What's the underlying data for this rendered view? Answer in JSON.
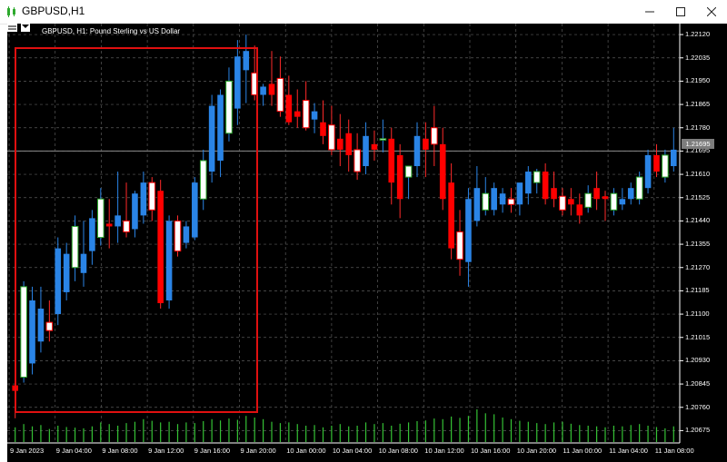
{
  "window": {
    "title": "GBPUSD,H1",
    "buttons": [
      "minimize",
      "maximize",
      "close"
    ]
  },
  "chart": {
    "title": "GBPUSD, H1:  Pound Sterling vs US Dollar",
    "current_price": "1.21695",
    "price_axis": [
      "1.22120",
      "1.22035",
      "1.21950",
      "1.21865",
      "1.21780",
      "1.21695",
      "1.21610",
      "1.21525",
      "1.21440",
      "1.21355",
      "1.21270",
      "1.21185",
      "1.21100",
      "1.21015",
      "1.20930",
      "1.20845",
      "1.20760",
      "1.20675"
    ],
    "time_axis": [
      "9 Jan 2023",
      "9 Jan 04:00",
      "9 Jan 08:00",
      "9 Jan 12:00",
      "9 Jan 16:00",
      "9 Jan 20:00",
      "10 Jan 00:00",
      "10 Jan 04:00",
      "10 Jan 08:00",
      "10 Jan 12:00",
      "10 Jan 16:00",
      "10 Jan 20:00",
      "11 Jan 00:00",
      "11 Jan 04:00",
      "11 Jan 08:00"
    ],
    "colors": {
      "background": "#000000",
      "grid": "#5a5a5a",
      "bull_body": "#2a84e6",
      "bear_body": "#ff0000",
      "highlight_rect": "#e01010",
      "volume": "#35c235",
      "wick_up": "#2a84e6",
      "wick_down": "#ff2a2a"
    }
  },
  "chart_data": {
    "type": "candlestick",
    "symbol": "GBPUSD",
    "timeframe": "H1",
    "ylim": [
      1.2063,
      1.2216
    ],
    "note_candle_style": "alternating fill pattern as shown",
    "candles": [
      {
        "o": 1.2084,
        "h": 1.209,
        "l": 1.2072,
        "c": 1.2082
      },
      {
        "o": 1.2087,
        "h": 1.2122,
        "l": 1.2085,
        "c": 1.212
      },
      {
        "o": 1.2092,
        "h": 1.212,
        "l": 1.2088,
        "c": 1.2115
      },
      {
        "o": 1.21,
        "h": 1.212,
        "l": 1.2096,
        "c": 1.2112
      },
      {
        "o": 1.2107,
        "h": 1.2115,
        "l": 1.21,
        "c": 1.2104
      },
      {
        "o": 1.211,
        "h": 1.2138,
        "l": 1.2106,
        "c": 1.2134
      },
      {
        "o": 1.2118,
        "h": 1.2136,
        "l": 1.2115,
        "c": 1.2132
      },
      {
        "o": 1.2127,
        "h": 1.2146,
        "l": 1.2122,
        "c": 1.2142
      },
      {
        "o": 1.2125,
        "h": 1.2144,
        "l": 1.212,
        "c": 1.2132
      },
      {
        "o": 1.2133,
        "h": 1.2148,
        "l": 1.2128,
        "c": 1.2145
      },
      {
        "o": 1.2138,
        "h": 1.2156,
        "l": 1.2135,
        "c": 1.2152
      },
      {
        "o": 1.2143,
        "h": 1.2152,
        "l": 1.2134,
        "c": 1.2142
      },
      {
        "o": 1.2142,
        "h": 1.2162,
        "l": 1.2136,
        "c": 1.2146
      },
      {
        "o": 1.2144,
        "h": 1.2158,
        "l": 1.2138,
        "c": 1.214
      },
      {
        "o": 1.2141,
        "h": 1.2155,
        "l": 1.2138,
        "c": 1.2154
      },
      {
        "o": 1.2146,
        "h": 1.2162,
        "l": 1.2143,
        "c": 1.2158
      },
      {
        "o": 1.2158,
        "h": 1.216,
        "l": 1.2144,
        "c": 1.2148
      },
      {
        "o": 1.2155,
        "h": 1.2159,
        "l": 1.2112,
        "c": 1.2114
      },
      {
        "o": 1.2115,
        "h": 1.2146,
        "l": 1.2112,
        "c": 1.2144
      },
      {
        "o": 1.2144,
        "h": 1.2146,
        "l": 1.2131,
        "c": 1.2133
      },
      {
        "o": 1.2136,
        "h": 1.2144,
        "l": 1.2134,
        "c": 1.2142
      },
      {
        "o": 1.2138,
        "h": 1.216,
        "l": 1.2137,
        "c": 1.2158
      },
      {
        "o": 1.2152,
        "h": 1.217,
        "l": 1.2148,
        "c": 1.2166
      },
      {
        "o": 1.2162,
        "h": 1.219,
        "l": 1.2158,
        "c": 1.2186
      },
      {
        "o": 1.2166,
        "h": 1.2192,
        "l": 1.216,
        "c": 1.219
      },
      {
        "o": 1.2176,
        "h": 1.22,
        "l": 1.2173,
        "c": 1.2195
      },
      {
        "o": 1.2185,
        "h": 1.221,
        "l": 1.2179,
        "c": 1.2204
      },
      {
        "o": 1.2199,
        "h": 1.2212,
        "l": 1.2187,
        "c": 1.2206
      },
      {
        "o": 1.2198,
        "h": 1.2208,
        "l": 1.2188,
        "c": 1.219
      },
      {
        "o": 1.219,
        "h": 1.2194,
        "l": 1.2186,
        "c": 1.2193
      },
      {
        "o": 1.2194,
        "h": 1.2206,
        "l": 1.2186,
        "c": 1.219
      },
      {
        "o": 1.2196,
        "h": 1.2204,
        "l": 1.2182,
        "c": 1.2184
      },
      {
        "o": 1.219,
        "h": 1.2197,
        "l": 1.2179,
        "c": 1.218
      },
      {
        "o": 1.2184,
        "h": 1.2192,
        "l": 1.2178,
        "c": 1.2182
      },
      {
        "o": 1.2188,
        "h": 1.2195,
        "l": 1.2177,
        "c": 1.2178
      },
      {
        "o": 1.2181,
        "h": 1.2187,
        "l": 1.2176,
        "c": 1.2184
      },
      {
        "o": 1.218,
        "h": 1.2188,
        "l": 1.2172,
        "c": 1.2175
      },
      {
        "o": 1.2179,
        "h": 1.2186,
        "l": 1.2168,
        "c": 1.217
      },
      {
        "o": 1.2174,
        "h": 1.2183,
        "l": 1.2164,
        "c": 1.217
      },
      {
        "o": 1.2176,
        "h": 1.2181,
        "l": 1.2162,
        "c": 1.2168
      },
      {
        "o": 1.217,
        "h": 1.2176,
        "l": 1.2159,
        "c": 1.2162
      },
      {
        "o": 1.2164,
        "h": 1.218,
        "l": 1.2161,
        "c": 1.2175
      },
      {
        "o": 1.2172,
        "h": 1.2177,
        "l": 1.2166,
        "c": 1.217
      },
      {
        "o": 1.2174,
        "h": 1.2181,
        "l": 1.2169,
        "c": 1.2174
      },
      {
        "o": 1.2174,
        "h": 1.2178,
        "l": 1.215,
        "c": 1.2158
      },
      {
        "o": 1.2168,
        "h": 1.2172,
        "l": 1.2145,
        "c": 1.2152
      },
      {
        "o": 1.216,
        "h": 1.2164,
        "l": 1.2152,
        "c": 1.2164
      },
      {
        "o": 1.2164,
        "h": 1.218,
        "l": 1.216,
        "c": 1.2175
      },
      {
        "o": 1.2174,
        "h": 1.218,
        "l": 1.216,
        "c": 1.217
      },
      {
        "o": 1.2178,
        "h": 1.2186,
        "l": 1.2164,
        "c": 1.2172
      },
      {
        "o": 1.2172,
        "h": 1.2178,
        "l": 1.2148,
        "c": 1.2152
      },
      {
        "o": 1.2158,
        "h": 1.2165,
        "l": 1.213,
        "c": 1.2134
      },
      {
        "o": 1.214,
        "h": 1.2148,
        "l": 1.2124,
        "c": 1.213
      },
      {
        "o": 1.2129,
        "h": 1.2156,
        "l": 1.212,
        "c": 1.2152
      },
      {
        "o": 1.2144,
        "h": 1.2164,
        "l": 1.2142,
        "c": 1.2156
      },
      {
        "o": 1.2148,
        "h": 1.216,
        "l": 1.2146,
        "c": 1.2154
      },
      {
        "o": 1.2148,
        "h": 1.2158,
        "l": 1.2146,
        "c": 1.2156
      },
      {
        "o": 1.215,
        "h": 1.2156,
        "l": 1.2147,
        "c": 1.2154
      },
      {
        "o": 1.2152,
        "h": 1.2156,
        "l": 1.2147,
        "c": 1.215
      },
      {
        "o": 1.215,
        "h": 1.2156,
        "l": 1.2146,
        "c": 1.2158
      },
      {
        "o": 1.2154,
        "h": 1.2164,
        "l": 1.215,
        "c": 1.2162
      },
      {
        "o": 1.2158,
        "h": 1.2163,
        "l": 1.2154,
        "c": 1.2162
      },
      {
        "o": 1.2162,
        "h": 1.2165,
        "l": 1.215,
        "c": 1.2152
      },
      {
        "o": 1.2156,
        "h": 1.2162,
        "l": 1.2149,
        "c": 1.2152
      },
      {
        "o": 1.2153,
        "h": 1.2156,
        "l": 1.2146,
        "c": 1.2148
      },
      {
        "o": 1.2152,
        "h": 1.2156,
        "l": 1.2146,
        "c": 1.215
      },
      {
        "o": 1.215,
        "h": 1.2154,
        "l": 1.2143,
        "c": 1.2146
      },
      {
        "o": 1.2149,
        "h": 1.2157,
        "l": 1.2147,
        "c": 1.2154
      },
      {
        "o": 1.2156,
        "h": 1.2162,
        "l": 1.2148,
        "c": 1.2152
      },
      {
        "o": 1.2153,
        "h": 1.2155,
        "l": 1.2144,
        "c": 1.2152
      },
      {
        "o": 1.2148,
        "h": 1.2156,
        "l": 1.2146,
        "c": 1.2154
      },
      {
        "o": 1.215,
        "h": 1.2156,
        "l": 1.2148,
        "c": 1.2152
      },
      {
        "o": 1.2152,
        "h": 1.2158,
        "l": 1.215,
        "c": 1.2156
      },
      {
        "o": 1.2152,
        "h": 1.2162,
        "l": 1.215,
        "c": 1.216
      },
      {
        "o": 1.2156,
        "h": 1.217,
        "l": 1.2154,
        "c": 1.2168
      },
      {
        "o": 1.2168,
        "h": 1.2172,
        "l": 1.216,
        "c": 1.2162
      },
      {
        "o": 1.216,
        "h": 1.217,
        "l": 1.2158,
        "c": 1.2168
      },
      {
        "o": 1.2164,
        "h": 1.2178,
        "l": 1.2162,
        "c": 1.217
      }
    ],
    "volumes": [
      0.45,
      0.55,
      0.48,
      0.52,
      0.4,
      0.5,
      0.46,
      0.44,
      0.42,
      0.48,
      0.6,
      0.55,
      0.5,
      0.58,
      0.62,
      0.7,
      0.65,
      0.6,
      0.62,
      0.55,
      0.6,
      0.58,
      0.64,
      0.7,
      0.66,
      0.72,
      0.68,
      0.8,
      0.75,
      0.7,
      0.62,
      0.58,
      0.6,
      0.55,
      0.5,
      0.52,
      0.45,
      0.5,
      0.55,
      0.48,
      0.5,
      0.6,
      0.55,
      0.58,
      0.5,
      0.56,
      0.6,
      0.64,
      0.66,
      0.72,
      0.7,
      0.78,
      0.74,
      0.8,
      1.0,
      0.88,
      0.85,
      0.75,
      0.7,
      0.65,
      0.62,
      0.58,
      0.55,
      0.6,
      0.62,
      0.56,
      0.52,
      0.5,
      0.48,
      0.45,
      0.5,
      0.48,
      0.52,
      0.55,
      0.5,
      0.46,
      0.42,
      0.48
    ]
  }
}
